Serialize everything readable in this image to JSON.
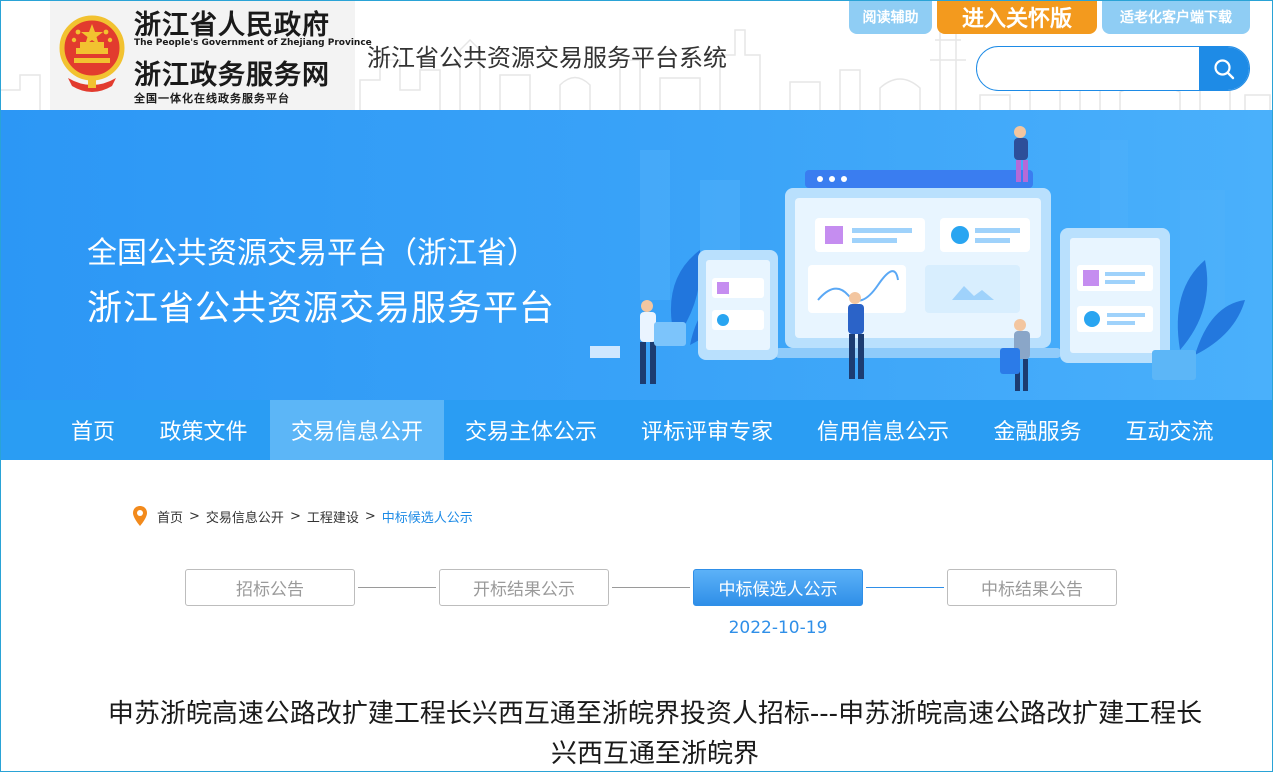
{
  "header": {
    "gov_name_cn": "浙江省人民政府",
    "gov_name_en": "The People's Government of Zhejiang Province",
    "service_name_cn": "浙江政务服务网",
    "service_slogan": "全国一体化在线政务服务平台",
    "system_title": "浙江省公共资源交易服务平台系统",
    "buttons": {
      "reading_aid": "阅读辅助",
      "care_mode": "进入关怀版",
      "elderly_app": "适老化客户端下载"
    },
    "search": {
      "placeholder": "",
      "value": ""
    }
  },
  "banner": {
    "title_line1": "全国公共资源交易平台（浙江省）",
    "title_line2": "浙江省公共资源交易服务平台"
  },
  "nav": {
    "items": [
      {
        "label": "首页"
      },
      {
        "label": "政策文件"
      },
      {
        "label": "交易信息公开"
      },
      {
        "label": "交易主体公示"
      },
      {
        "label": "评标评审专家"
      },
      {
        "label": "信用信息公示"
      },
      {
        "label": "金融服务"
      },
      {
        "label": "互动交流"
      }
    ],
    "active_index": 2
  },
  "breadcrumb": {
    "items": [
      "首页",
      "交易信息公开",
      "工程建设",
      "中标候选人公示"
    ],
    "separator": ">"
  },
  "steps": {
    "items": [
      {
        "label": "招标公告"
      },
      {
        "label": "开标结果公示"
      },
      {
        "label": "中标候选人公示"
      },
      {
        "label": "中标结果公告"
      }
    ],
    "active_index": 2,
    "active_date": "2022-10-19"
  },
  "article": {
    "title": "申苏浙皖高速公路改扩建工程长兴西互通至浙皖界投资人招标---申苏浙皖高速公路改扩建工程长兴西互通至浙皖界"
  },
  "colors": {
    "primary_blue": "#2a9df3",
    "nav_active": "#5cb6f7",
    "care_orange": "#f39a1e",
    "light_pill": "#8fcdf4",
    "link_blue": "#1e8be6"
  }
}
